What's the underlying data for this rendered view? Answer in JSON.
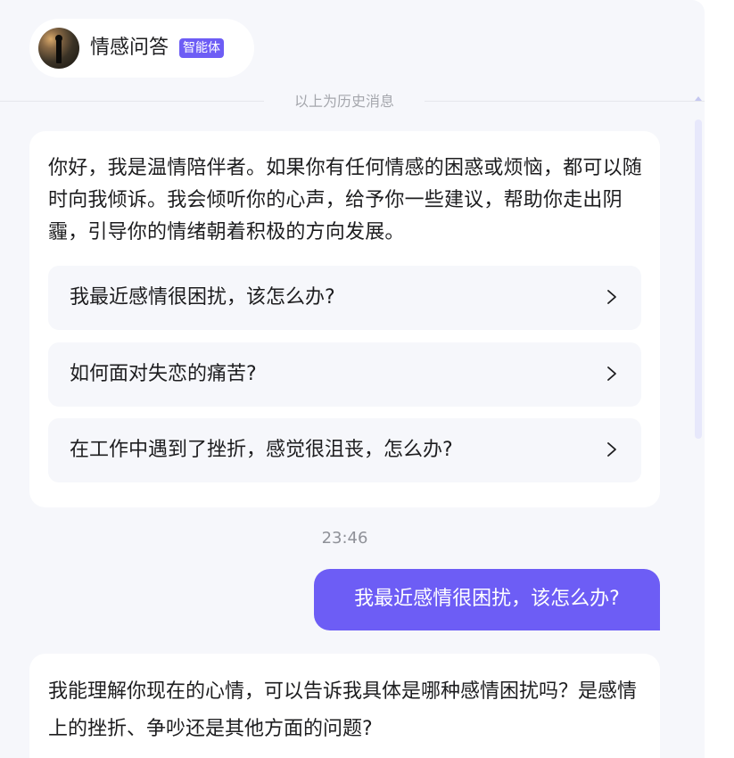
{
  "header": {
    "agent_name": "情感问答",
    "agent_badge": "智能体",
    "avatar_icon": "avatar-image"
  },
  "history_divider": "以上为历史消息",
  "messages": [
    {
      "role": "assistant",
      "text": "你好，我是温情陪伴者。如果你有任何情感的困惑或烦恼，都可以随时向我倾诉。我会倾听你的心声，给予你一些建议，帮助你走出阴霾，引导你的情绪朝着积极的方向发展。",
      "suggestions": [
        {
          "label": "我最近感情很困扰，该怎么办?",
          "icon": "chevron-right-icon"
        },
        {
          "label": "如何面对失恋的痛苦?",
          "icon": "chevron-right-icon"
        },
        {
          "label": "在工作中遇到了挫折，感觉很沮丧，怎么办?",
          "icon": "chevron-right-icon"
        }
      ]
    },
    {
      "role": "timestamp",
      "text": "23:46"
    },
    {
      "role": "user",
      "text": "我最近感情很困扰，该怎么办?"
    },
    {
      "role": "assistant",
      "text": "我能理解你现在的心情，可以告诉我具体是哪种感情困扰吗？是感情上的挫折、争吵还是其他方面的问题?"
    }
  ],
  "colors": {
    "accent": "#6d5df5",
    "panel_background": "#f6f7fb",
    "bubble_background": "#ffffff",
    "text_primary": "#1d1d1f",
    "text_muted": "#a5a7ad"
  }
}
